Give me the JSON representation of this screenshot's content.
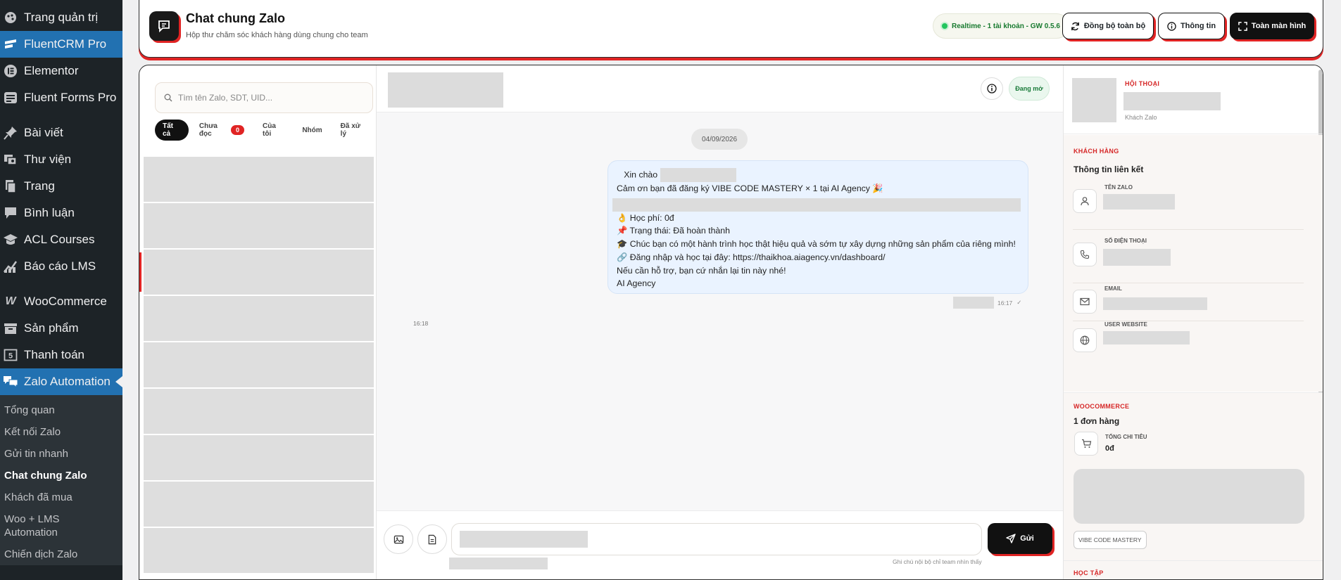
{
  "sidebar": {
    "items": [
      {
        "label": "Trang quản trị"
      },
      {
        "label": "FluentCRM Pro"
      },
      {
        "label": "Elementor"
      },
      {
        "label": "Fluent Forms Pro"
      },
      {
        "label": "Bài viết"
      },
      {
        "label": "Thư viện"
      },
      {
        "label": "Trang"
      },
      {
        "label": "Bình luận"
      },
      {
        "label": "ACL Courses"
      },
      {
        "label": "Báo cáo LMS"
      },
      {
        "label": "WooCommerce"
      },
      {
        "label": "Sản phẩm"
      },
      {
        "label": "Thanh toán"
      },
      {
        "label": "Zalo Automation"
      }
    ],
    "submenu": [
      {
        "label": "Tổng quan"
      },
      {
        "label": "Kết nối Zalo"
      },
      {
        "label": "Gửi tin nhanh"
      },
      {
        "label": "Chat chung Zalo"
      },
      {
        "label": "Khách đã mua"
      },
      {
        "label": "Woo + LMS Automation"
      },
      {
        "label": "Chiến dịch Zalo"
      }
    ]
  },
  "header": {
    "title": "Chat chung Zalo",
    "subtitle": "Hộp thư chăm sóc khách hàng dùng chung cho team",
    "realtime": "Realtime - 1 tài khoản - GW 0.5.6",
    "sync_label": "Đồng bộ toàn bộ",
    "info_label": "Thông tin",
    "fullscreen_label": "Toàn màn hình"
  },
  "conversations": {
    "search_placeholder": "Tìm tên Zalo, SDT, UID...",
    "filters": {
      "all": "Tất cả",
      "unread": "Chưa đọc",
      "unread_count": "0",
      "mine": "Của tôi",
      "group": "Nhóm",
      "done": "Đã xử lý"
    }
  },
  "chat": {
    "status": "Đang mở",
    "date": "04/09/2026",
    "message_lines": {
      "greeting": "Xin chào",
      "line2": "Cảm ơn bạn đã đăng ký VIBE CODE MASTERY × 1 tại AI Agency 🎉",
      "fee": "Học phí: 0đ",
      "status": "📌 Trạng thái: Đã hoàn thành",
      "wish": "🎓 Chúc bạn có một hành trình học thật hiệu quả và sớm tự xây dựng những sản phẩm của riêng mình!",
      "login": "🔗 Đăng nhập và học tại đây: https://thaikhoa.aiagency.vn/dashboard/",
      "support": "Nếu cần hỗ trợ, bạn cứ nhắn lại tin này nhé!",
      "sign": "AI Agency"
    },
    "message_time": "16:17",
    "check": "✓",
    "other_time": "16:18",
    "send_label": "Gửi",
    "note": "Ghi chú nội bộ chỉ team nhìn thấy"
  },
  "details": {
    "conversation_label": "HỘI THOẠI",
    "contact_type": "Khách Zalo",
    "customer_label": "KHÁCH HÀNG",
    "customer_title": "Thông tin liên kết",
    "fields": {
      "zalo_name": "TÊN ZALO",
      "phone": "SỐ ĐIỆN THOẠI",
      "email": "EMAIL",
      "website": "USER WEBSITE"
    },
    "woo_label": "WOOCOMMERCE",
    "orders": "1 đơn hàng",
    "spend_label": "TỔNG CHI TIÊU",
    "spend_value": "0đ",
    "course_tag": "VIBE CODE MASTERY",
    "study_label": "HỌC TẬP"
  },
  "colors": {
    "accent_red": "#e02424",
    "wp_blue": "#2271b1",
    "wp_dark": "#1d2327"
  }
}
